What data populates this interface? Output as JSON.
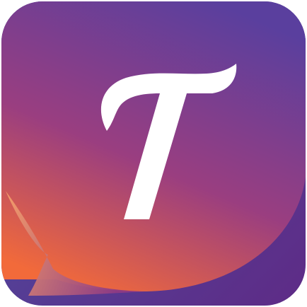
{
  "app_icon": {
    "glyph": "T",
    "colors": {
      "tile_top": "#4C4FA3",
      "tile_bottom": "#5E2B86",
      "bubble_top": "#5A3F9E",
      "bubble_mid": "#9A3E80",
      "bubble_bottom": "#F26A3A",
      "tail_light": "#F6A06A",
      "tail_dark": "#8E3A84",
      "glyph": "#FFFFFF"
    }
  }
}
